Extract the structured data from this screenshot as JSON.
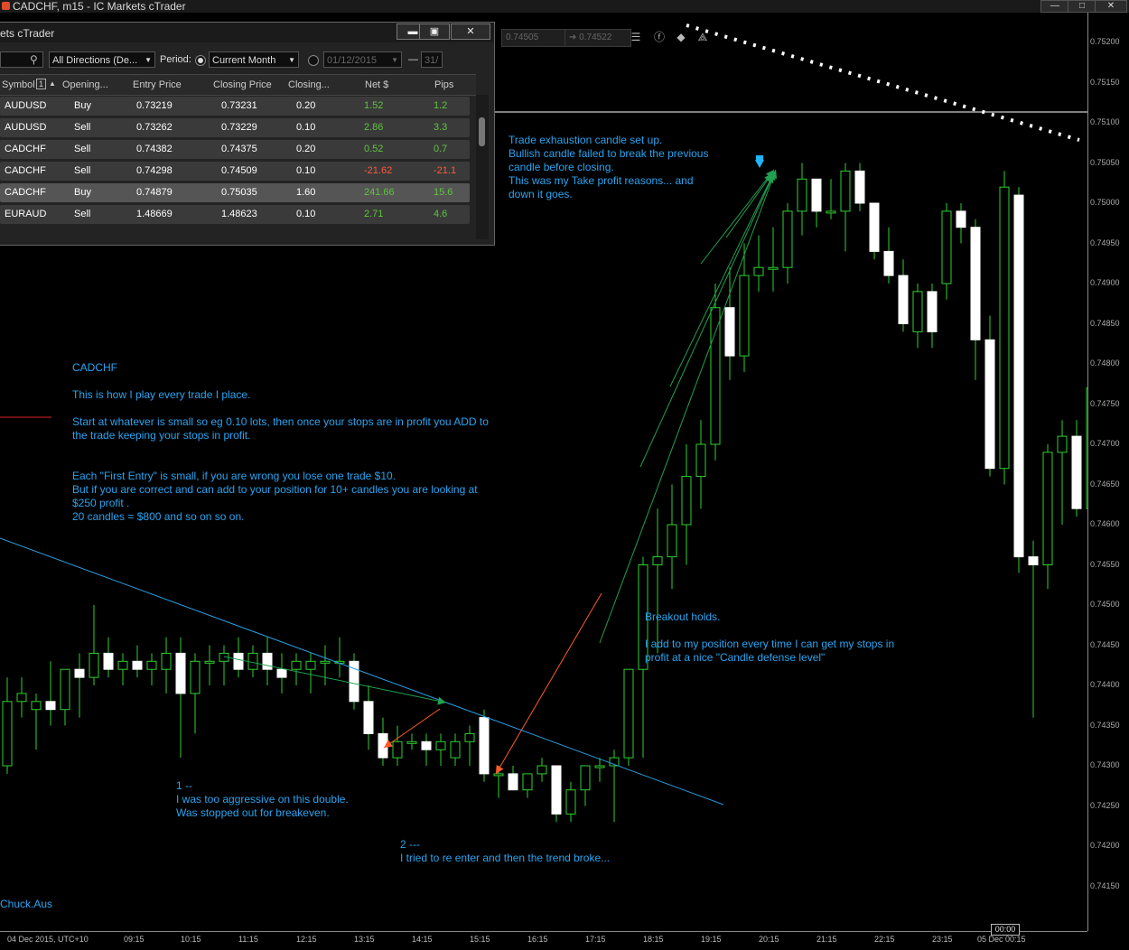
{
  "window": {
    "title": "CADCHF, m15 - IC Markets cTrader",
    "controls": [
      "—",
      "□",
      "✕"
    ]
  },
  "toolbar": {
    "bid": "0.74505",
    "ask": "0.74522"
  },
  "history": {
    "title": "ets cTrader",
    "controls": [
      "▬",
      "▣",
      "✕"
    ],
    "filter": {
      "direction": "All Directions (De...",
      "period_label": "Period:",
      "period": "Current Month",
      "from_date": "01/12/2015",
      "dash": "—",
      "to_date": "31/"
    },
    "columns": [
      "Symbol",
      "Opening...",
      "Entry Price",
      "Closing Price",
      "Closing...",
      "Net $",
      "Pips"
    ],
    "sort_badge": "1",
    "rows": [
      {
        "symbol": "AUDUSD",
        "dir": "Buy",
        "entry": "0.73219",
        "close": "0.73231",
        "vol": "0.20",
        "net": "1.52",
        "pips": "1.2"
      },
      {
        "symbol": "AUDUSD",
        "dir": "Sell",
        "entry": "0.73262",
        "close": "0.73229",
        "vol": "0.10",
        "net": "2.86",
        "pips": "3.3"
      },
      {
        "symbol": "CADCHF",
        "dir": "Sell",
        "entry": "0.74382",
        "close": "0.74375",
        "vol": "0.20",
        "net": "0.52",
        "pips": "0.7"
      },
      {
        "symbol": "CADCHF",
        "dir": "Sell",
        "entry": "0.74298",
        "close": "0.74509",
        "vol": "0.10",
        "net": "-21.62",
        "pips": "-21.1"
      },
      {
        "symbol": "CADCHF",
        "dir": "Buy",
        "entry": "0.74879",
        "close": "0.75035",
        "vol": "1.60",
        "net": "241.66",
        "pips": "15.6"
      },
      {
        "symbol": "EURAUD",
        "dir": "Sell",
        "entry": "1.48669",
        "close": "1.48623",
        "vol": "0.10",
        "net": "2.71",
        "pips": "4.6"
      }
    ]
  },
  "annotations": {
    "exhaustion": "Trade exhaustion candle set up.\nBullish candle failed to break the previous\ncandle before closing.\nThis was my Take profit reasons... and\ndown it goes.",
    "strategy": "CADCHF\n\nThis is how I play every trade I place.\n\nStart at whatever is small so eg 0.10 lots, then once your stops are in profit you ADD to\nthe trade keeping your stops in profit.\n\n\nEach \"First Entry\" is small, if you are wrong you lose one trade $10.\nBut if you are correct and can add to your position for 10+ candles you are looking at\n$250 profit .\n20 candles = $800 and so on so on.",
    "breakout": "Breakout holds.\n\nI add to my position every time I can get my stops in\nprofit at a nice \"Candle defense level\"",
    "first": "1 --\nI was too aggressive on this double.\nWas stopped out for breakeven.",
    "second": "2 ---\nI tried to re enter and then the trend broke...",
    "author": "Chuck.Aus"
  },
  "price_axis": [
    "0.75200",
    "0.75150",
    "0.75100",
    "0.75050",
    "0.75000",
    "0.74950",
    "0.74900",
    "0.74850",
    "0.74800",
    "0.74750",
    "0.74700",
    "0.74650",
    "0.74600",
    "0.74550",
    "0.74500",
    "0.74450",
    "0.74400",
    "0.74350",
    "0.74300",
    "0.74250",
    "0.74200",
    "0.74150"
  ],
  "time_axis": {
    "start": "04 Dec 2015, UTC+10",
    "labels": [
      "09:15",
      "10:15",
      "11:15",
      "12:15",
      "13:15",
      "14:15",
      "15:15",
      "16:15",
      "17:15",
      "18:15",
      "19:15",
      "20:15",
      "21:15",
      "22:15",
      "23:15",
      "05 Dec 00:15"
    ],
    "marker": "00:00"
  },
  "colors": {
    "bull": "#ffffff",
    "bear": "#ffffff",
    "wick": "#2fd02f",
    "trend": "#2a9ee0",
    "loss_arrow": "#ff5a2a",
    "win_arrow": "#20a050"
  },
  "chart_data": {
    "type": "candlestick",
    "ylim": [
      0.7412,
      0.7523
    ],
    "candles": [
      {
        "o": 0.743,
        "h": 0.7441,
        "l": 0.7429,
        "c": 0.7438
      },
      {
        "o": 0.7438,
        "h": 0.7441,
        "l": 0.7436,
        "c": 0.7439
      },
      {
        "o": 0.7437,
        "h": 0.7439,
        "l": 0.7432,
        "c": 0.7438
      },
      {
        "o": 0.7438,
        "h": 0.7443,
        "l": 0.7435,
        "c": 0.7437
      },
      {
        "o": 0.7437,
        "h": 0.7442,
        "l": 0.7435,
        "c": 0.7442
      },
      {
        "o": 0.7442,
        "h": 0.7444,
        "l": 0.7436,
        "c": 0.7441
      },
      {
        "o": 0.7441,
        "h": 0.745,
        "l": 0.744,
        "c": 0.7444
      },
      {
        "o": 0.7444,
        "h": 0.7446,
        "l": 0.7441,
        "c": 0.7442
      },
      {
        "o": 0.7442,
        "h": 0.7444,
        "l": 0.744,
        "c": 0.7443
      },
      {
        "o": 0.7443,
        "h": 0.7445,
        "l": 0.7441,
        "c": 0.7442
      },
      {
        "o": 0.7442,
        "h": 0.7444,
        "l": 0.744,
        "c": 0.7443
      },
      {
        "o": 0.7442,
        "h": 0.7446,
        "l": 0.7439,
        "c": 0.7444
      },
      {
        "o": 0.7444,
        "h": 0.7446,
        "l": 0.7431,
        "c": 0.7439
      },
      {
        "o": 0.7439,
        "h": 0.7444,
        "l": 0.7434,
        "c": 0.7443
      },
      {
        "o": 0.7443,
        "h": 0.7445,
        "l": 0.744,
        "c": 0.7443
      },
      {
        "o": 0.7443,
        "h": 0.7445,
        "l": 0.744,
        "c": 0.7444
      },
      {
        "o": 0.7444,
        "h": 0.7446,
        "l": 0.7441,
        "c": 0.7442
      },
      {
        "o": 0.7442,
        "h": 0.7445,
        "l": 0.7441,
        "c": 0.7444
      },
      {
        "o": 0.7444,
        "h": 0.7446,
        "l": 0.744,
        "c": 0.7442
      },
      {
        "o": 0.7442,
        "h": 0.7444,
        "l": 0.7439,
        "c": 0.7441
      },
      {
        "o": 0.7442,
        "h": 0.7444,
        "l": 0.744,
        "c": 0.7443
      },
      {
        "o": 0.7442,
        "h": 0.7444,
        "l": 0.7439,
        "c": 0.7443
      },
      {
        "o": 0.7443,
        "h": 0.7445,
        "l": 0.744,
        "c": 0.7443
      },
      {
        "o": 0.7443,
        "h": 0.7446,
        "l": 0.7441,
        "c": 0.7443
      },
      {
        "o": 0.7443,
        "h": 0.7444,
        "l": 0.7437,
        "c": 0.7438
      },
      {
        "o": 0.7438,
        "h": 0.744,
        "l": 0.7432,
        "c": 0.7434
      },
      {
        "o": 0.7434,
        "h": 0.7436,
        "l": 0.743,
        "c": 0.7431
      },
      {
        "o": 0.7431,
        "h": 0.7435,
        "l": 0.743,
        "c": 0.7433
      },
      {
        "o": 0.7433,
        "h": 0.7434,
        "l": 0.7432,
        "c": 0.7433
      },
      {
        "o": 0.7433,
        "h": 0.7434,
        "l": 0.743,
        "c": 0.7432
      },
      {
        "o": 0.7432,
        "h": 0.7434,
        "l": 0.743,
        "c": 0.7433
      },
      {
        "o": 0.7431,
        "h": 0.7434,
        "l": 0.743,
        "c": 0.7433
      },
      {
        "o": 0.7433,
        "h": 0.7435,
        "l": 0.743,
        "c": 0.7434
      },
      {
        "o": 0.7436,
        "h": 0.7437,
        "l": 0.7428,
        "c": 0.7429
      },
      {
        "o": 0.7429,
        "h": 0.743,
        "l": 0.7426,
        "c": 0.7429
      },
      {
        "o": 0.7429,
        "h": 0.743,
        "l": 0.7427,
        "c": 0.7427
      },
      {
        "o": 0.7427,
        "h": 0.7429,
        "l": 0.7426,
        "c": 0.7429
      },
      {
        "o": 0.7429,
        "h": 0.7431,
        "l": 0.7428,
        "c": 0.743
      },
      {
        "o": 0.743,
        "h": 0.743,
        "l": 0.7423,
        "c": 0.7424
      },
      {
        "o": 0.7424,
        "h": 0.7428,
        "l": 0.7423,
        "c": 0.7427
      },
      {
        "o": 0.7427,
        "h": 0.743,
        "l": 0.7425,
        "c": 0.743
      },
      {
        "o": 0.743,
        "h": 0.7431,
        "l": 0.7428,
        "c": 0.743
      },
      {
        "o": 0.743,
        "h": 0.7432,
        "l": 0.7423,
        "c": 0.7431
      },
      {
        "o": 0.7431,
        "h": 0.7436,
        "l": 0.743,
        "c": 0.7442
      },
      {
        "o": 0.7442,
        "h": 0.7456,
        "l": 0.7431,
        "c": 0.7455
      },
      {
        "o": 0.7455,
        "h": 0.7462,
        "l": 0.7444,
        "c": 0.7456
      },
      {
        "o": 0.7456,
        "h": 0.7465,
        "l": 0.7452,
        "c": 0.746
      },
      {
        "o": 0.746,
        "h": 0.747,
        "l": 0.7455,
        "c": 0.7466
      },
      {
        "o": 0.7466,
        "h": 0.7473,
        "l": 0.7462,
        "c": 0.747
      },
      {
        "o": 0.747,
        "h": 0.749,
        "l": 0.7468,
        "c": 0.7487
      },
      {
        "o": 0.7487,
        "h": 0.7492,
        "l": 0.7478,
        "c": 0.7481
      },
      {
        "o": 0.7481,
        "h": 0.7495,
        "l": 0.7479,
        "c": 0.7491
      },
      {
        "o": 0.7491,
        "h": 0.7496,
        "l": 0.7489,
        "c": 0.7492
      },
      {
        "o": 0.7492,
        "h": 0.7497,
        "l": 0.7489,
        "c": 0.7492
      },
      {
        "o": 0.7492,
        "h": 0.75,
        "l": 0.749,
        "c": 0.7499
      },
      {
        "o": 0.7499,
        "h": 0.7505,
        "l": 0.7496,
        "c": 0.7503
      },
      {
        "o": 0.7503,
        "h": 0.7503,
        "l": 0.7497,
        "c": 0.7499
      },
      {
        "o": 0.7499,
        "h": 0.7503,
        "l": 0.7498,
        "c": 0.7499
      },
      {
        "o": 0.7499,
        "h": 0.7505,
        "l": 0.7494,
        "c": 0.7504
      },
      {
        "o": 0.7504,
        "h": 0.7505,
        "l": 0.7499,
        "c": 0.75
      },
      {
        "o": 0.75,
        "h": 0.75,
        "l": 0.7493,
        "c": 0.7494
      },
      {
        "o": 0.7494,
        "h": 0.7497,
        "l": 0.749,
        "c": 0.7491
      },
      {
        "o": 0.7491,
        "h": 0.7493,
        "l": 0.7484,
        "c": 0.7485
      },
      {
        "o": 0.7484,
        "h": 0.749,
        "l": 0.7482,
        "c": 0.7489
      },
      {
        "o": 0.7489,
        "h": 0.749,
        "l": 0.7482,
        "c": 0.7484
      },
      {
        "o": 0.749,
        "h": 0.75,
        "l": 0.7488,
        "c": 0.7499
      },
      {
        "o": 0.7499,
        "h": 0.75,
        "l": 0.7495,
        "c": 0.7497
      },
      {
        "o": 0.7497,
        "h": 0.7498,
        "l": 0.7478,
        "c": 0.7483
      },
      {
        "o": 0.7483,
        "h": 0.7486,
        "l": 0.7466,
        "c": 0.7467
      },
      {
        "o": 0.7467,
        "h": 0.7504,
        "l": 0.7465,
        "c": 0.7502
      },
      {
        "o": 0.7501,
        "h": 0.7502,
        "l": 0.7454,
        "c": 0.7456
      },
      {
        "o": 0.7456,
        "h": 0.7458,
        "l": 0.7436,
        "c": 0.7455
      },
      {
        "o": 0.7455,
        "h": 0.747,
        "l": 0.7452,
        "c": 0.7469
      },
      {
        "o": 0.7469,
        "h": 0.7473,
        "l": 0.746,
        "c": 0.7471
      },
      {
        "o": 0.7471,
        "h": 0.7473,
        "l": 0.7461,
        "c": 0.7462
      },
      {
        "o": 0.7462,
        "h": 0.7478,
        "l": 0.746,
        "c": 0.7477
      },
      {
        "o": 0.7477,
        "h": 0.748,
        "l": 0.747,
        "c": 0.7478
      },
      {
        "o": 0.7478,
        "h": 0.7482,
        "l": 0.7475,
        "c": 0.7481
      },
      {
        "o": 0.7481,
        "h": 0.7487,
        "l": 0.7479,
        "c": 0.7486
      }
    ]
  }
}
